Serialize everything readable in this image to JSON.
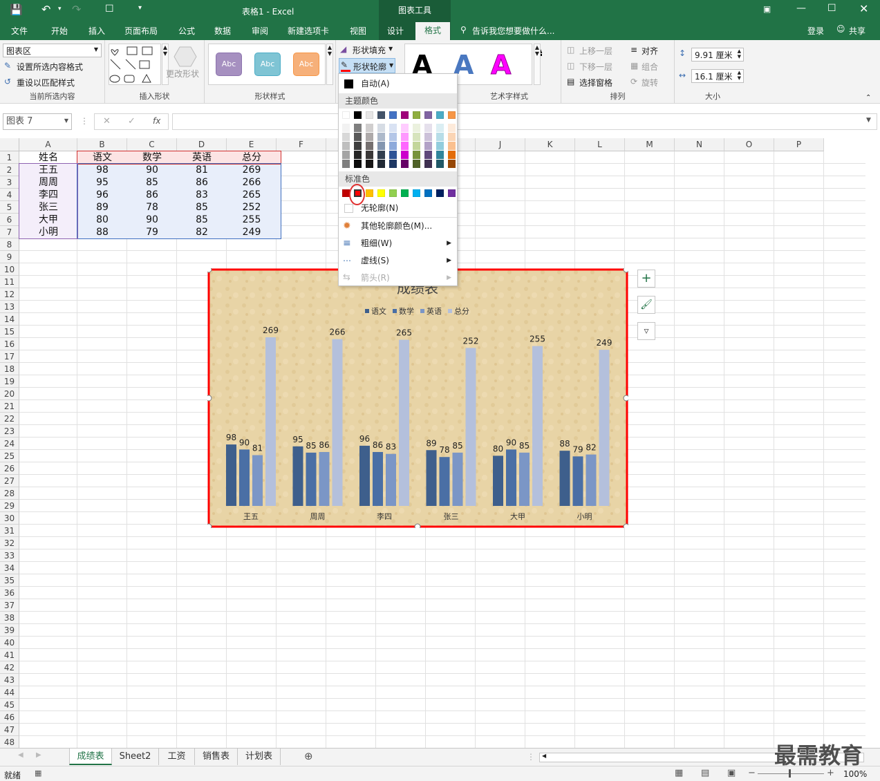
{
  "titlebar": {
    "title": "表格1 - Excel",
    "contextual": "图表工具"
  },
  "tabs": [
    "文件",
    "开始",
    "插入",
    "页面布局",
    "公式",
    "数据",
    "审阅",
    "新建选项卡",
    "视图",
    "设计",
    "格式"
  ],
  "tell_me": "告诉我您想要做什么...",
  "account": {
    "login": "登录",
    "share": "共享"
  },
  "ribbon": {
    "current_selection": {
      "combo": "图表区",
      "format_selection": "设置所选内容格式",
      "reset_style": "重设以匹配样式",
      "label": "当前所选内容"
    },
    "insert_shapes": {
      "change_shape": "更改形状",
      "label": "插入形状"
    },
    "shape_styles": {
      "abc": "Abc",
      "fill": "形状填充",
      "outline": "形状轮廓",
      "label": "形状样式"
    },
    "wordart": {
      "letter": "A",
      "label": "艺术字样式"
    },
    "arrange": {
      "bring_forward": "上移一层",
      "send_backward": "下移一层",
      "selection_pane": "选择窗格",
      "align": "对齐",
      "group": "组合",
      "rotate": "旋转",
      "label": "排列"
    },
    "size": {
      "height": "9.91 厘米",
      "width": "16.1 厘米",
      "label": "大小"
    }
  },
  "formula": {
    "namebox": "图表 7",
    "fx": "fx"
  },
  "columns": [
    "A",
    "B",
    "C",
    "D",
    "E",
    "F",
    "G",
    "H",
    "I",
    "J",
    "K",
    "L",
    "M",
    "N",
    "O",
    "P"
  ],
  "rows": [
    "1",
    "2",
    "3",
    "4",
    "5",
    "6",
    "7",
    "8",
    "9",
    "10",
    "11",
    "12",
    "13",
    "14",
    "15",
    "16",
    "17",
    "18",
    "19",
    "20",
    "21",
    "22",
    "23",
    "24",
    "25",
    "26",
    "27",
    "28",
    "29",
    "30",
    "31",
    "32",
    "33",
    "34",
    "35",
    "36",
    "37",
    "38",
    "39",
    "40",
    "41",
    "42",
    "43",
    "44",
    "45",
    "46",
    "47",
    "48"
  ],
  "table": {
    "headers": [
      "姓名",
      "语文",
      "数学",
      "英语",
      "总分"
    ],
    "rows": [
      [
        "王五",
        "98",
        "90",
        "81",
        "269"
      ],
      [
        "周周",
        "95",
        "85",
        "86",
        "266"
      ],
      [
        "李四",
        "96",
        "86",
        "83",
        "265"
      ],
      [
        "张三",
        "89",
        "78",
        "85",
        "252"
      ],
      [
        "大甲",
        "80",
        "90",
        "85",
        "255"
      ],
      [
        "小明",
        "88",
        "79",
        "82",
        "249"
      ]
    ]
  },
  "dropdown": {
    "auto": "自动(A)",
    "theme_colors": "主题颜色",
    "standard_colors": "标准色",
    "no_outline": "无轮廓(N)",
    "more_colors": "其他轮廓颜色(M)...",
    "weight": "粗细(W)",
    "dashes": "虚线(S)",
    "arrows": "箭头(R)",
    "theme_top": [
      "#ffffff",
      "#000000",
      "#e7e6e6",
      "#44546a",
      "#4472c4",
      "#a0007a",
      "#8fae3f",
      "#8064a2",
      "#4bacc6",
      "#f79646"
    ],
    "theme_shades": [
      [
        "#f2f2f2",
        "#7f7f7f",
        "#d0cece",
        "#d6dce4",
        "#d9e2f3",
        "#ffccff",
        "#ebf1de",
        "#e5e0ec",
        "#dbeef3",
        "#fdeada"
      ],
      [
        "#d8d8d8",
        "#595959",
        "#aeaaaa",
        "#adb9ca",
        "#b4c6e7",
        "#ff99ff",
        "#d7e4bd",
        "#ccc1d9",
        "#b7dde8",
        "#fbd5b5"
      ],
      [
        "#bfbfbf",
        "#3f3f3f",
        "#757070",
        "#8496b0",
        "#8eaadb",
        "#ff66ff",
        "#c3d69b",
        "#b2a2c7",
        "#93cddd",
        "#fac08f"
      ],
      [
        "#a5a5a5",
        "#262626",
        "#3a3838",
        "#323f4f",
        "#2f5496",
        "#cc00cc",
        "#77933c",
        "#5f497a",
        "#31859b",
        "#e36c09"
      ],
      [
        "#7f7f7f",
        "#0c0c0c",
        "#171616",
        "#222a35",
        "#1f3864",
        "#660066",
        "#4f6228",
        "#3f3151",
        "#205867",
        "#974806"
      ]
    ],
    "standard": [
      "#c00000",
      "#ff0000",
      "#ffc000",
      "#ffff00",
      "#92d050",
      "#00b050",
      "#00b0f0",
      "#0070c0",
      "#002060",
      "#7030a0"
    ]
  },
  "chart_data": {
    "type": "bar",
    "title": "成绩表",
    "categories": [
      "王五",
      "周周",
      "李四",
      "张三",
      "大甲",
      "小明"
    ],
    "series": [
      {
        "name": "语文",
        "values": [
          98,
          95,
          96,
          89,
          80,
          88
        ],
        "color": "#3e5f8c"
      },
      {
        "name": "数学",
        "values": [
          90,
          85,
          86,
          78,
          90,
          79
        ],
        "color": "#4a6fa5"
      },
      {
        "name": "英语",
        "values": [
          81,
          86,
          83,
          85,
          85,
          82
        ],
        "color": "#7b96c6"
      },
      {
        "name": "总分",
        "values": [
          269,
          266,
          265,
          252,
          255,
          249
        ],
        "color": "#b4c0dc"
      }
    ],
    "ylim": [
      0,
      280
    ],
    "legend": "top",
    "grid": false,
    "outline_color": "#ff0000"
  },
  "side_buttons": {
    "add": "+"
  },
  "sheet_tabs": [
    "成绩表",
    "Sheet2",
    "工资",
    "销售表",
    "计划表"
  ],
  "status": {
    "ready": "就绪",
    "zoom": "100%"
  },
  "watermark": "最需教育"
}
